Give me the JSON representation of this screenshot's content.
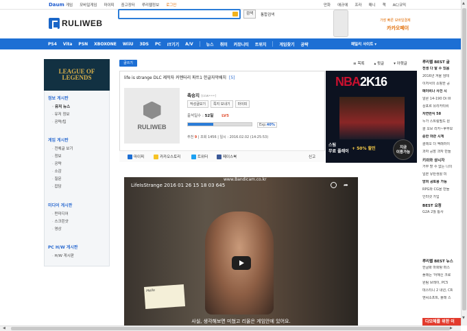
{
  "topbar": {
    "daum": "Daum",
    "links": [
      "게임",
      "모바일게임",
      "마이피",
      "중고장터",
      "루리웹정보",
      "로그인"
    ],
    "right_links": [
      "만화",
      "애규에",
      "프라",
      "매니",
      "책",
      "AC/코믹"
    ]
  },
  "header": {
    "logo": "RULIWEB",
    "search_placeholder": "",
    "search_button": "검색",
    "total_search": "통합검색",
    "ad_line1": "가장 빠른 모바일결제",
    "ad_line2": "카카오페이"
  },
  "nav": {
    "items": [
      "PS4",
      "Vita",
      "PSN",
      "XBOXONE",
      "WiiU",
      "3DS",
      "PC",
      "IT기기",
      "A/V",
      "뉴스",
      "취미",
      "커뮤니티",
      "트위치",
      "게임찾기",
      "공략"
    ],
    "family": "패밀리 사이트 ▾"
  },
  "sidebar": {
    "ad": "LEAGUE OF LEGENDS",
    "sections": [
      {
        "title": "정보 게시판",
        "items": [
          "유저 뉴스",
          "유저 정보",
          "공략/팁"
        ]
      },
      {
        "title": "게임 게시판",
        "items": [
          "전체글 보기",
          "정보",
          "공략",
          "소감",
          "질문",
          "잡담"
        ]
      },
      {
        "title": "미디어 게시판",
        "items": [
          "펀미디어",
          "스크린샷",
          "영상"
        ]
      },
      {
        "title": "PC H/W 게시판",
        "items": [
          "H/W 게시판"
        ]
      }
    ]
  },
  "toolbar": {
    "write": "글쓰기",
    "list": "≡ 목록",
    "up": "▴ 윗글",
    "down": "▾ 아랫글"
  },
  "post": {
    "title": "life is strange DLC 제작자 커멘터리 파트1 한글자막배치",
    "comment_count": "[5]",
    "thumb_label": "RULIWEB",
    "author": "촉승지",
    "author_sub": "(ccw•••)",
    "tags": [
      "작성글보기",
      "쪽지 보내기",
      "마이피"
    ],
    "attend_label": "출석일수 :",
    "attend_value": "52일",
    "level": "LV5",
    "exp_label": "Exp.",
    "exp_value": "40%",
    "exp_fraction": 0.4,
    "stats": "추천",
    "stats_reco": "9",
    "stats_rest": "| 조회 1456 | 일시 : 2016.02.02 (14:25:53)",
    "share": [
      "마이피",
      "카카오스토리",
      "트위터",
      "페이스북"
    ],
    "report": "신고"
  },
  "ad_nba": {
    "logo_a": "NBA",
    "logo_b": "2K16",
    "line1": "스팀\n무료 플레이",
    "line2": "+ 50% 할인",
    "now": "지금\n이용가능"
  },
  "video": {
    "title": "LifeIsStrange 2016 01 26 15 18 03 645",
    "watermark": "www.Bandicam.co.kr",
    "paper_text": "Hello",
    "subtitle": "사실, 생각해보면 미쳤고 리올은 게임안에 있어요."
  },
  "right": {
    "blocks": [
      {
        "title": "루리웹 BEST 글",
        "items": [
          "전생 다 탈 수 있음",
          "2016년 겨울 임테",
          "이저서의 쇼핑한 공",
          "메이비나 사건 시",
          "알론 14-190 Di III",
          "상포르 유리카티비",
          "자연번식 58",
          "누가 스트링필드 원",
          "콜 오브 리카~후무모",
          "준한 마관 시계",
          "클레오 더 액래러이",
          "과자 공장 과자 만들"
        ]
      },
      {
        "title": "키쉬와 샹시자",
        "items": [
          "거부 할 수 없는 나의",
          "일본 유탄생활 미",
          "방의 공토용 가능",
          "RPG와 CG을 만들",
          "인터넷 가입"
        ]
      },
      {
        "title": "BEST 요청",
        "items": [
          "G2A 2월 통사"
        ]
      },
      {
        "title": "루리웹 BEST 뉴스",
        "items": [
          "한글화 마화탕 퍼스",
          "플래는 '어해신 크로",
          "원팀 브레이, PC5",
          "데스티니 2 내년, CR",
          "엔씨소프트, 플래 스"
        ]
      }
    ],
    "red_button": "다모헤를 위한 이"
  }
}
